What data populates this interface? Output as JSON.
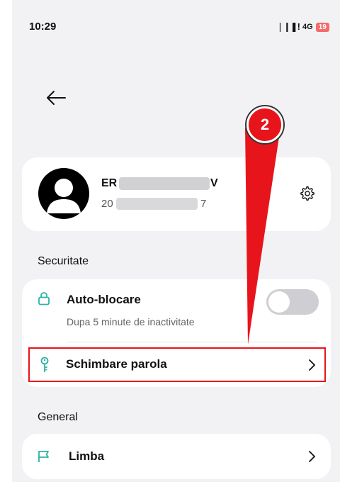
{
  "status_bar": {
    "time": "10:29",
    "signal": "❘❙❚!",
    "network": "4G",
    "battery": "19"
  },
  "profile": {
    "name_visible": "ER",
    "name_suffix": "V",
    "id_visible": "20",
    "id_suffix": "7"
  },
  "security": {
    "title": "Securitate",
    "auto_lock": {
      "label": "Auto-blocare",
      "sublabel": "Dupa 5 minute de inactivitate",
      "enabled": false
    },
    "change_password": {
      "label": "Schimbare parola"
    }
  },
  "general": {
    "title": "General",
    "language": {
      "label": "Limba"
    }
  },
  "annotation": {
    "step": "2",
    "color": "#e8141b"
  },
  "colors": {
    "accent": "#2bb3a3",
    "background": "#f2f2f4",
    "card": "#ffffff"
  }
}
